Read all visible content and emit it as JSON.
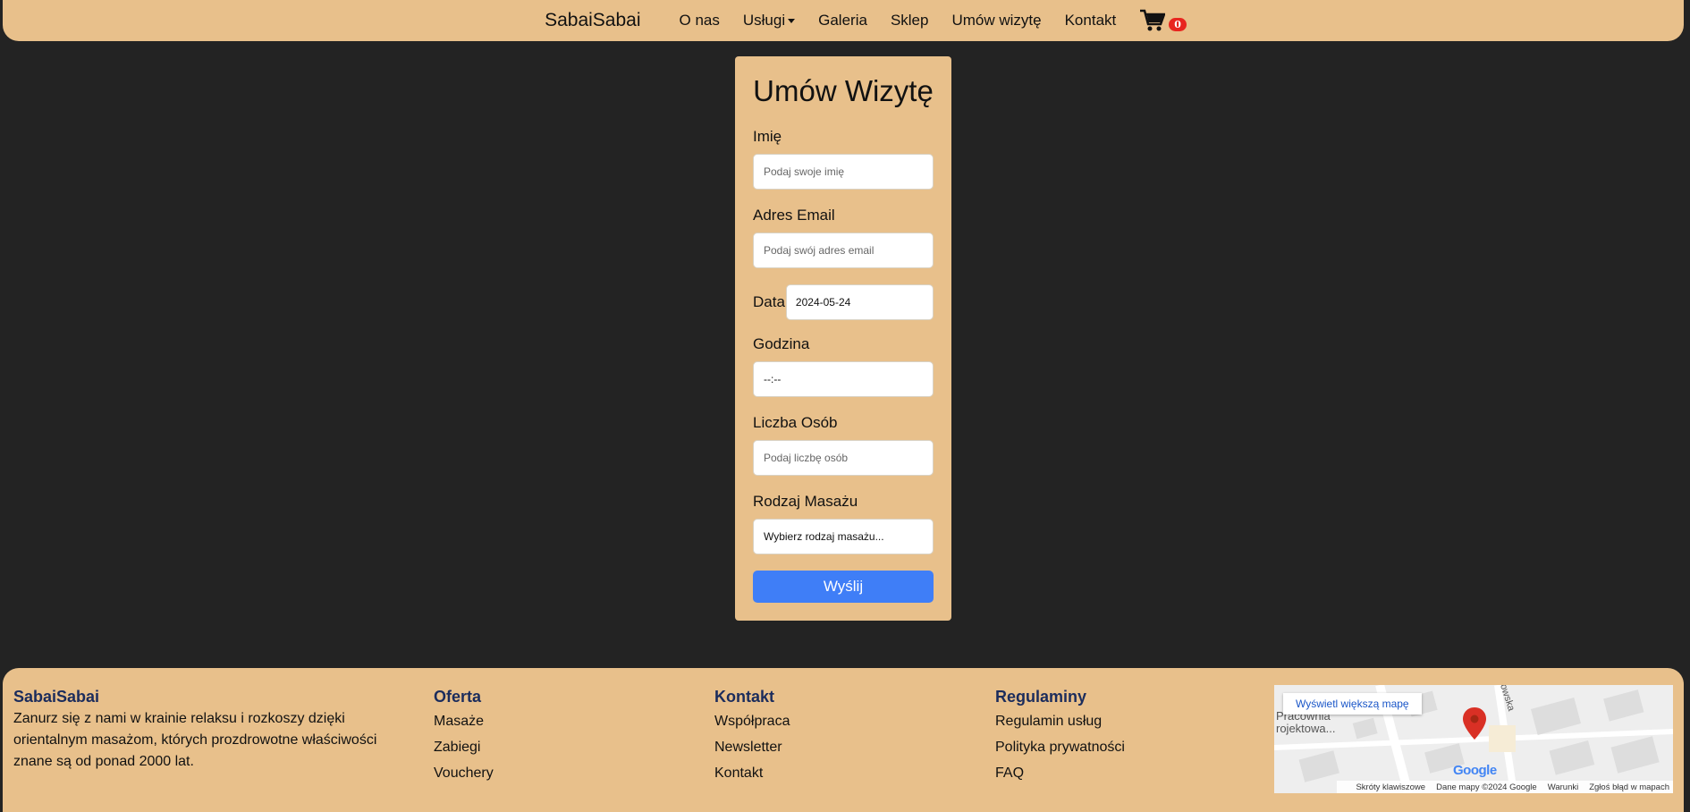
{
  "nav": {
    "brand": "SabaiSabai",
    "links": [
      "O nas",
      "Usługi",
      "Galeria",
      "Sklep",
      "Umów wizytę",
      "Kontakt"
    ],
    "cart_icon": "shopping-cart-icon",
    "cart_count": "0"
  },
  "form": {
    "title": "Umów Wizytę",
    "name_label": "Imię",
    "name_placeholder": "Podaj swoje imię",
    "email_label": "Adres Email",
    "email_placeholder": "Podaj swój adres email",
    "date_label": "Data",
    "date_value": "2024-05-24",
    "time_label": "Godzina",
    "time_value": "--:--",
    "people_label": "Liczba Osób",
    "people_placeholder": "Podaj liczbę osób",
    "massage_label": "Rodzaj Masażu",
    "massage_selected": "Wybierz rodzaj masażu...",
    "submit_label": "Wyślij",
    "submit_color": "#3f7ef7"
  },
  "footer": {
    "about": {
      "title": "SabaiSabai",
      "text": "Zanurz się z nami w krainie relaksu i rozkoszy dzięki orientalnym masażom, których prozdrowotne właściwości znane są od ponad 2000 lat."
    },
    "offer": {
      "title": "Oferta",
      "links": [
        "Masaże",
        "Zabiegi",
        "Vouchery"
      ]
    },
    "contact": {
      "title": "Kontakt",
      "links": [
        "Współpraca",
        "Newsletter",
        "Kontakt"
      ]
    },
    "rules": {
      "title": "Regulaminy",
      "links": [
        "Regulamin usług",
        "Polityka prywatności",
        "FAQ"
      ]
    },
    "map": {
      "button": "Wyświetl większą mapę",
      "place_label_1": "Pracownia",
      "place_label_2": "rojektowa...",
      "street": "owska",
      "logo": "Google",
      "keyboard": "Skróty klawiszowe",
      "data": "Dane mapy ©2024 Google",
      "terms": "Warunki",
      "report": "Zgłoś błąd w mapach"
    }
  },
  "colors": {
    "background": "#232323",
    "accent": "#e8c08b",
    "heading": "#1b2c5c"
  }
}
